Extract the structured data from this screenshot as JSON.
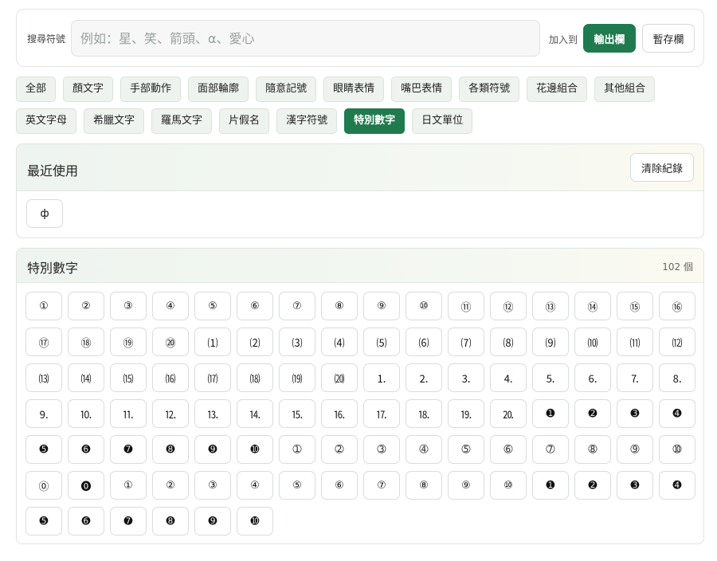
{
  "search": {
    "label": "搜尋符號",
    "placeholder": "例如：星、笑、箭頭、α、愛心",
    "add_to_label": "加入到",
    "output_button": "輸出欄",
    "temp_button": "暫存欄"
  },
  "categories": {
    "row1": [
      "全部",
      "顏文字",
      "手部動作",
      "面部輪廓",
      "隨意記號",
      "眼睛表情",
      "嘴巴表情",
      "各類符號",
      "花邊組合",
      "其他組合"
    ],
    "row2": [
      "英文字母",
      "希臘文字",
      "羅馬文字",
      "片假名",
      "漢字符號",
      "特別數字",
      "日文單位"
    ],
    "active": "特別數字"
  },
  "recent": {
    "title": "最近使用",
    "clear_button": "清除紀錄",
    "items": [
      "ф"
    ]
  },
  "special": {
    "title": "特別數字",
    "count": "102 個",
    "symbols": [
      "①",
      "②",
      "③",
      "④",
      "⑤",
      "⑥",
      "⑦",
      "⑧",
      "⑨",
      "⑩",
      "⑪",
      "⑫",
      "⑬",
      "⑭",
      "⑮",
      "⑯",
      "⑰",
      "⑱",
      "⑲",
      "⑳",
      "⑴",
      "⑵",
      "⑶",
      "⑷",
      "⑸",
      "⑹",
      "⑺",
      "⑻",
      "⑼",
      "⑽",
      "⑾",
      "⑿",
      "⒀",
      "⒁",
      "⒂",
      "⒃",
      "⒄",
      "⒅",
      "⒆",
      "⒇",
      "⒈",
      "⒉",
      "⒊",
      "⒋",
      "⒌",
      "⒍",
      "⒎",
      "⒏",
      "⒐",
      "⒑",
      "⒒",
      "⒓",
      "⒔",
      "⒕",
      "⒖",
      "⒗",
      "⒘",
      "⒙",
      "⒚",
      "⒛",
      "➊",
      "➋",
      "➌",
      "➍",
      "➎",
      "➏",
      "➐",
      "➑",
      "➒",
      "➓",
      "➀",
      "➁",
      "➂",
      "➃",
      "➄",
      "➅",
      "➆",
      "➇",
      "➈",
      "➉",
      "⓪",
      "⓿",
      "①",
      "②",
      "③",
      "④",
      "⑤",
      "⑥",
      "⑦",
      "⑧",
      "⑨",
      "⑩",
      "➊",
      "➋",
      "➌",
      "➍",
      "➎",
      "➏",
      "➐",
      "➑",
      "➒",
      "➓"
    ]
  }
}
